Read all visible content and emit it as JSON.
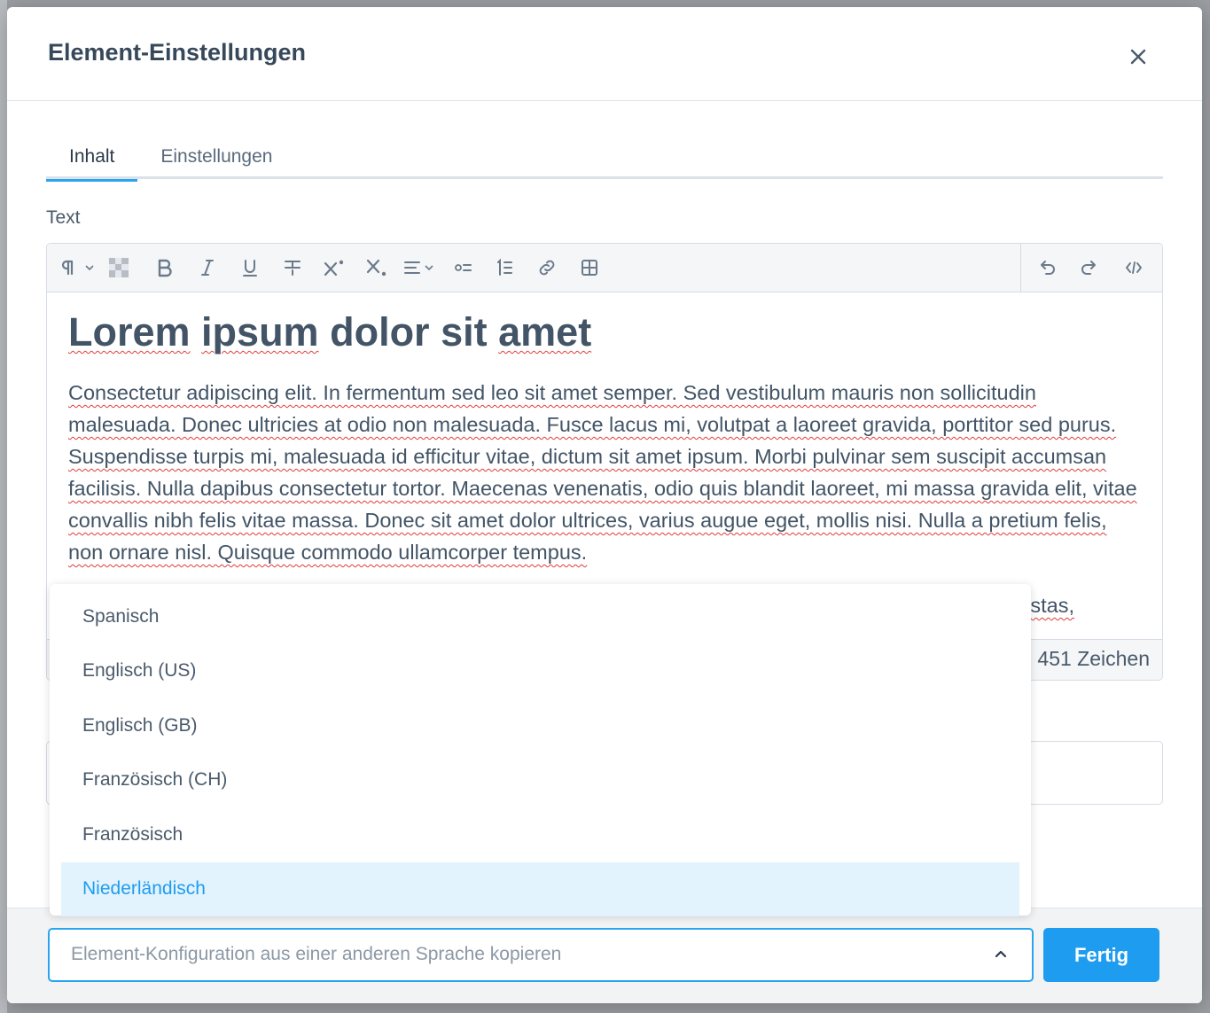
{
  "dialog": {
    "title": "Element-Einstellungen",
    "close_icon": "close-icon"
  },
  "tabs": [
    {
      "label": "Inhalt",
      "active": true
    },
    {
      "label": "Einstellungen",
      "active": false
    }
  ],
  "field": {
    "label": "Text"
  },
  "toolbar": {
    "icons": [
      "paragraph-format-icon",
      "background-color-icon",
      "bold-icon",
      "italic-icon",
      "underline-icon",
      "strikethrough-icon",
      "superscript-icon",
      "subscript-icon",
      "align-icon",
      "bullet-list-icon",
      "numbered-list-icon",
      "link-icon",
      "table-icon",
      "undo-icon",
      "redo-icon",
      "source-code-icon"
    ]
  },
  "editor": {
    "heading": [
      "Lorem",
      "ipsum",
      "dolor",
      "sit",
      "amet"
    ],
    "paragraph": "Consectetur adipiscing elit. In fermentum sed leo sit amet semper. Sed vestibulum mauris non sollicitudin malesuada. Donec ultricies at odio non malesuada. Fusce lacus mi, volutpat a laoreet gravida, porttitor sed purus. Suspendisse turpis mi, malesuada id efficitur vitae, dictum sit amet ipsum. Morbi pulvinar sem suscipit accumsan facilisis. Nulla dapibus consectetur tortor. Maecenas venenatis, odio quis blandit laoreet, mi massa gravida elit, vitae convallis nibh felis vitae massa. Donec sit amet dolor ultrices, varius augue eget, mollis nisi. Nulla a pretium felis, non ornare nisl. Quisque commodo ullamcorper tempus.",
    "partial_text": "estas,",
    "char_count": "451 Zeichen"
  },
  "language_dropdown": {
    "options": [
      "Spanisch",
      "Englisch (US)",
      "Englisch (GB)",
      "Französisch (CH)",
      "Französisch",
      "Niederländisch"
    ],
    "highlighted": "Niederländisch"
  },
  "footer": {
    "copy_select_placeholder": "Element-Konfiguration aus einer anderen Sprache kopieren",
    "done_label": "Fertig"
  },
  "colors": {
    "accent": "#1e9cf0",
    "text": "#425466",
    "spellcheck": "#e03c3c"
  }
}
